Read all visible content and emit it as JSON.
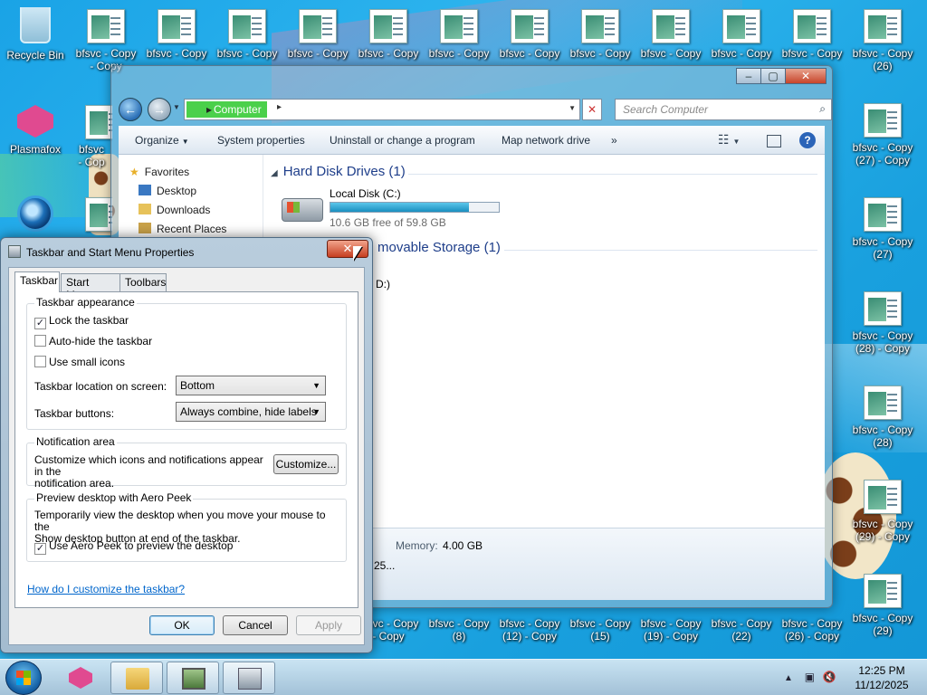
{
  "desktop": {
    "row1": [
      "Recycle Bin",
      "bfsvc - Copy",
      "bfsvc - Copy",
      "bfsvc - Copy",
      "bfsvc - Copy",
      "bfsvc - Copy",
      "bfsvc - Copy",
      "bfsvc - Copy",
      "bfsvc - Copy",
      "bfsvc - Copy",
      "bfsvc - Copy",
      "bfsvc - Copy",
      "bfsvc - Copy"
    ],
    "row1_sub": [
      "",
      "- Copy",
      "",
      "",
      "",
      "",
      "",
      "",
      "",
      "",
      "",
      "",
      "(26)"
    ],
    "plasmafox": "Plasmafox",
    "col2_label": "bfsvc",
    "col2_sub": "- Cop",
    "right_col": [
      {
        "label": "bfsvc - Copy",
        "sub": "(27) - Copy"
      },
      {
        "label": "bfsvc - Copy",
        "sub": "(27)"
      },
      {
        "label": "bfsvc - Copy",
        "sub": "(28) - Copy"
      },
      {
        "label": "bfsvc - Copy",
        "sub": "(28)"
      },
      {
        "label": "bfsvc - Copy",
        "sub": "(29) - Copy"
      },
      {
        "label": "bfsvc - Copy",
        "sub": "(29)"
      }
    ],
    "bottom_row": [
      {
        "label": "bfsvc - Copy",
        "sub": "- Copy"
      },
      {
        "label": "bfsvc - Copy",
        "sub": "(8)"
      },
      {
        "label": "bfsvc - Copy",
        "sub": "(12) - Copy"
      },
      {
        "label": "bfsvc - Copy",
        "sub": "(15)"
      },
      {
        "label": "bfsvc - Copy",
        "sub": "(19) - Copy"
      },
      {
        "label": "bfsvc - Copy",
        "sub": "(22)"
      },
      {
        "label": "bfsvc - Copy",
        "sub": "(26) - Copy"
      }
    ]
  },
  "explorer": {
    "address_crumb": "Computer",
    "search_placeholder": "Search Computer",
    "commands": [
      "Organize",
      "System properties",
      "Uninstall or change a program",
      "Map network drive",
      "»"
    ],
    "nav": {
      "favorites": "Favorites",
      "items": [
        "Desktop",
        "Downloads",
        "Recent Places"
      ]
    },
    "hdd_header": "Hard Disk Drives (1)",
    "removable_header": "movable Storage (1)",
    "disk": {
      "name": "Local Disk (C:)",
      "free": "10.6 GB free of 59.8 GB",
      "used_fraction": 0.823
    },
    "removable_partial": "D:)",
    "details_memory_label": "Memory:",
    "details_memory_value": "4.00 GB",
    "details_partial": "25..."
  },
  "dialog": {
    "title": "Taskbar and Start Menu Properties",
    "close_glyph": "✕",
    "tabs": [
      "Taskbar",
      "Start Menu",
      "Toolbars"
    ],
    "appearance": {
      "title": "Taskbar appearance",
      "lock": {
        "label": "Lock the taskbar",
        "checked": true
      },
      "autohide": {
        "label": "Auto-hide the taskbar",
        "checked": false
      },
      "small_icons": {
        "label": "Use small icons",
        "checked": false
      },
      "location_label": "Taskbar location on screen:",
      "location_value": "Bottom",
      "buttons_label": "Taskbar buttons:",
      "buttons_value": "Always combine, hide labels"
    },
    "notification": {
      "title": "Notification area",
      "text_line1": "Customize which icons and notifications appear in the",
      "text_line2": "notification area.",
      "customize": "Customize..."
    },
    "peek": {
      "title": "Preview desktop with Aero Peek",
      "text_line1": "Temporarily view the desktop when you move your mouse to the",
      "text_line2": "Show desktop button at end of the taskbar.",
      "use": {
        "label": "Use Aero Peek to preview the desktop",
        "checked": true
      }
    },
    "help_link": "How do I customize the taskbar?",
    "ok": "OK",
    "cancel": "Cancel",
    "apply": "Apply"
  },
  "taskbar": {
    "time": "12:25 PM",
    "date": "11/12/2025"
  }
}
